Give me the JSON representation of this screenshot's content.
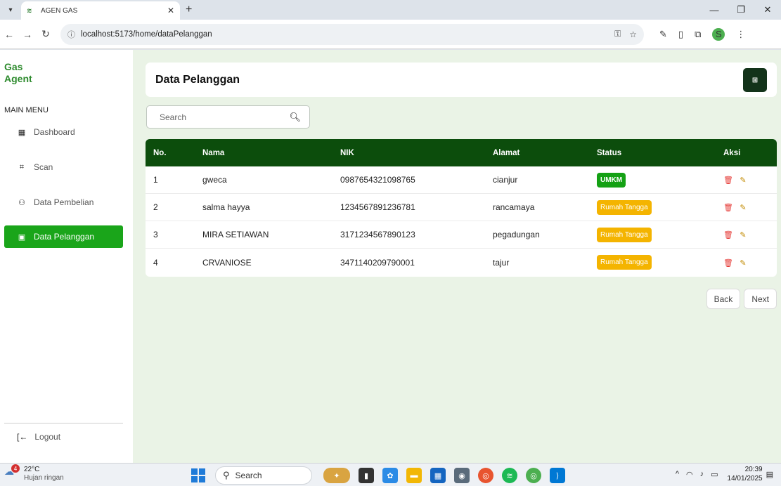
{
  "browser": {
    "tab_title": "AGEN GAS",
    "new_tab": "+",
    "url": "localhost:5173/home/dataPelanggan",
    "profile_initial": "S"
  },
  "sidebar": {
    "brand_line1": "Gas",
    "brand_line2": "Agent",
    "menu_heading": "MAIN MENU",
    "items": [
      {
        "label": "Dashboard",
        "icon": "grid-icon"
      },
      {
        "label": "Scan",
        "icon": "scan-icon"
      },
      {
        "label": "Data Pembelian",
        "icon": "users-icon"
      },
      {
        "label": "Data Pelanggan",
        "icon": "id-card-icon"
      }
    ],
    "logout": "Logout"
  },
  "page": {
    "title": "Data Pelanggan",
    "search_placeholder": "Search"
  },
  "table": {
    "headers": {
      "no": "No.",
      "nama": "Nama",
      "nik": "NIK",
      "alamat": "Alamat",
      "status": "Status",
      "aksi": "Aksi"
    },
    "rows": [
      {
        "no": "1",
        "nama": "gweca",
        "nik": "0987654321098765",
        "alamat": "cianjur",
        "status": "UMKM"
      },
      {
        "no": "2",
        "nama": "salma hayya",
        "nik": "1234567891236781",
        "alamat": "rancamaya",
        "status": "Rumah Tangga"
      },
      {
        "no": "3",
        "nama": "MIRA SETIAWAN",
        "nik": "3171234567890123",
        "alamat": "pegadungan",
        "status": "Rumah Tangga"
      },
      {
        "no": "4",
        "nama": "CRVANIOSE",
        "nik": "3471140209790001",
        "alamat": "tajur",
        "status": "Rumah Tangga"
      }
    ]
  },
  "pagination": {
    "back": "Back",
    "next": "Next"
  },
  "taskbar": {
    "temperature": "22°C",
    "weather": "Hujan ringan",
    "weather_badge": "4",
    "search": "Search",
    "time": "20:39",
    "date": "14/01/2025"
  },
  "colors": {
    "brand_green": "#1aa51a",
    "header_green": "#0c4d0c",
    "badge_umkm": "#14a114",
    "badge_rt": "#f4b400"
  }
}
